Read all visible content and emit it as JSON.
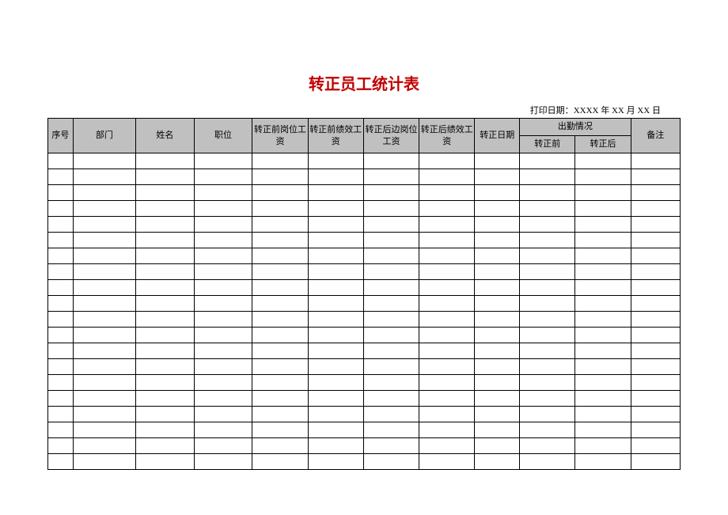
{
  "title": "转正员工统计表",
  "print_date_label": "打印日期：",
  "print_date_value": "XXXX 年 XX 月 XX 日",
  "headers": {
    "seq": "序号",
    "dept": "部门",
    "name": "姓名",
    "position": "职位",
    "pre_post_salary": "转正前岗位工资",
    "pre_perf_salary": "转正前绩效工资",
    "post_post_salary": "转正后边岗位工资",
    "post_perf_salary": "转正后绩效工资",
    "reg_date": "转正日期",
    "attendance": "出勤情况",
    "att_before": "转正前",
    "att_after": "转正后",
    "remark": "备注"
  },
  "rows": [
    {},
    {},
    {},
    {},
    {},
    {},
    {},
    {},
    {},
    {},
    {},
    {},
    {},
    {},
    {},
    {},
    {},
    {},
    {},
    {}
  ]
}
